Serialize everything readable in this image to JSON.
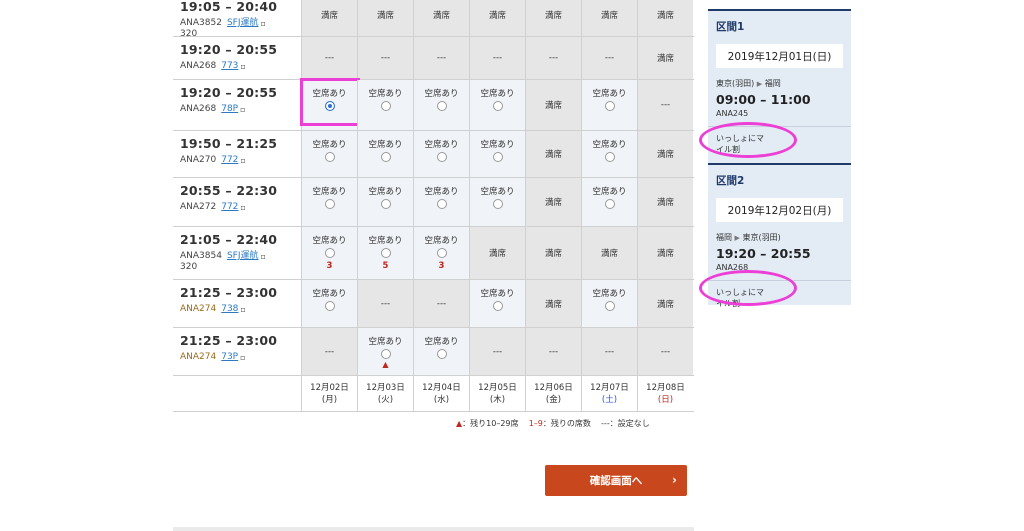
{
  "flights": [
    {
      "time": "19:05 – 20:40",
      "number": "ANA3852",
      "link": "SFJ運航",
      "aircraft": "320",
      "gold": false,
      "cells": [
        {
          "type": "gray",
          "text": "満席"
        },
        {
          "type": "gray",
          "text": "満席"
        },
        {
          "type": "gray",
          "text": "満席"
        },
        {
          "type": "gray",
          "text": "満席"
        },
        {
          "type": "gray",
          "text": "満席"
        },
        {
          "type": "gray",
          "text": "満席"
        },
        {
          "type": "gray",
          "text": "満席"
        }
      ]
    },
    {
      "time": "19:20 – 20:55",
      "number": "ANA268",
      "link": "773",
      "aircraft": "",
      "gold": false,
      "cells": [
        {
          "type": "gray",
          "text": "---"
        },
        {
          "type": "gray",
          "text": "---"
        },
        {
          "type": "gray",
          "text": "---"
        },
        {
          "type": "gray",
          "text": "---"
        },
        {
          "type": "gray",
          "text": "---"
        },
        {
          "type": "gray",
          "text": "---"
        },
        {
          "type": "gray",
          "text": "満席"
        }
      ]
    },
    {
      "time": "19:20 – 20:55",
      "number": "ANA268",
      "link": "78P",
      "aircraft": "",
      "gold": false,
      "cells": [
        {
          "type": "avail",
          "text": "空席あり",
          "selected": true
        },
        {
          "type": "avail",
          "text": "空席あり"
        },
        {
          "type": "avail",
          "text": "空席あり"
        },
        {
          "type": "avail",
          "text": "空席あり"
        },
        {
          "type": "gray",
          "text": "満席"
        },
        {
          "type": "avail",
          "text": "空席あり"
        },
        {
          "type": "gray",
          "text": "---"
        }
      ]
    },
    {
      "time": "19:50 – 21:25",
      "number": "ANA270",
      "link": "772",
      "aircraft": "",
      "gold": false,
      "cells": [
        {
          "type": "avail",
          "text": "空席あり"
        },
        {
          "type": "avail",
          "text": "空席あり"
        },
        {
          "type": "avail",
          "text": "空席あり"
        },
        {
          "type": "avail",
          "text": "空席あり"
        },
        {
          "type": "gray",
          "text": "満席"
        },
        {
          "type": "avail",
          "text": "空席あり"
        },
        {
          "type": "gray",
          "text": "満席"
        }
      ]
    },
    {
      "time": "20:55 – 22:30",
      "number": "ANA272",
      "link": "772",
      "aircraft": "",
      "gold": false,
      "cells": [
        {
          "type": "avail",
          "text": "空席あり"
        },
        {
          "type": "avail",
          "text": "空席あり"
        },
        {
          "type": "avail",
          "text": "空席あり"
        },
        {
          "type": "avail",
          "text": "空席あり"
        },
        {
          "type": "gray",
          "text": "満席"
        },
        {
          "type": "avail",
          "text": "空席あり"
        },
        {
          "type": "gray",
          "text": "満席"
        }
      ]
    },
    {
      "time": "21:05 – 22:40",
      "number": "ANA3854",
      "link": "SFJ運航",
      "aircraft": "320",
      "gold": false,
      "cells": [
        {
          "type": "avail",
          "text": "空席あり",
          "remain": "3"
        },
        {
          "type": "avail",
          "text": "空席あり",
          "remain": "5"
        },
        {
          "type": "avail",
          "text": "空席あり",
          "remain": "3"
        },
        {
          "type": "gray",
          "text": "満席"
        },
        {
          "type": "gray",
          "text": "満席"
        },
        {
          "type": "gray",
          "text": "満席"
        },
        {
          "type": "gray",
          "text": "満席"
        }
      ]
    },
    {
      "time": "21:25 – 23:00",
      "number": "ANA274",
      "link": "738",
      "aircraft": "",
      "gold": true,
      "cells": [
        {
          "type": "avail",
          "text": "空席あり"
        },
        {
          "type": "gray",
          "text": "---"
        },
        {
          "type": "gray",
          "text": "---"
        },
        {
          "type": "avail",
          "text": "空席あり"
        },
        {
          "type": "gray",
          "text": "満席"
        },
        {
          "type": "avail",
          "text": "空席あり"
        },
        {
          "type": "gray",
          "text": "満席"
        }
      ]
    },
    {
      "time": "21:25 – 23:00",
      "number": "ANA274",
      "link": "73P",
      "aircraft": "",
      "gold": true,
      "cells": [
        {
          "type": "gray",
          "text": "---"
        },
        {
          "type": "avail",
          "text": "空席あり",
          "tri": "▲"
        },
        {
          "type": "avail",
          "text": "空席あり"
        },
        {
          "type": "gray",
          "text": "---"
        },
        {
          "type": "gray",
          "text": "---"
        },
        {
          "type": "gray",
          "text": "---"
        },
        {
          "type": "gray",
          "text": "---"
        }
      ]
    }
  ],
  "dates": [
    {
      "date": "12月02日",
      "dow": "(月)",
      "kind": ""
    },
    {
      "date": "12月03日",
      "dow": "(火)",
      "kind": ""
    },
    {
      "date": "12月04日",
      "dow": "(水)",
      "kind": ""
    },
    {
      "date": "12月05日",
      "dow": "(木)",
      "kind": ""
    },
    {
      "date": "12月06日",
      "dow": "(金)",
      "kind": ""
    },
    {
      "date": "12月07日",
      "dow": "(土)",
      "kind": "sat"
    },
    {
      "date": "12月08日",
      "dow": "(日)",
      "kind": "sun"
    }
  ],
  "legend": {
    "tri_mark": "▲",
    "tri_text": "：残り10–29席",
    "num_mark": "1–9",
    "num_text": "：残りの席数",
    "dash_mark": "---",
    "dash_text": "：設定なし"
  },
  "confirm_button": {
    "label": "確認画面へ",
    "chevron": "›"
  },
  "summary": {
    "seg1": {
      "title": "区間1",
      "date": "2019年12月01日(日)",
      "from": "東京(羽田)",
      "arrow": "▶",
      "to": "福岡",
      "time": "09:00 – 11:00",
      "flight": "ANA245",
      "fare_line1": "いっしょにマ",
      "fare_line2": "イル割"
    },
    "seg2": {
      "title": "区間2",
      "date": "2019年12月02日(月)",
      "from": "福岡",
      "arrow": "▶",
      "to": "東京(羽田)",
      "time": "19:20 – 20:55",
      "flight": "ANA268",
      "fare_line1": "いっしょにマ",
      "fare_line2": "イル割"
    }
  },
  "colors": {
    "highlight": "#ec3fd6",
    "button": "#c9471c",
    "panel": "#e3ebf5",
    "navy": "#1f3a6b"
  }
}
